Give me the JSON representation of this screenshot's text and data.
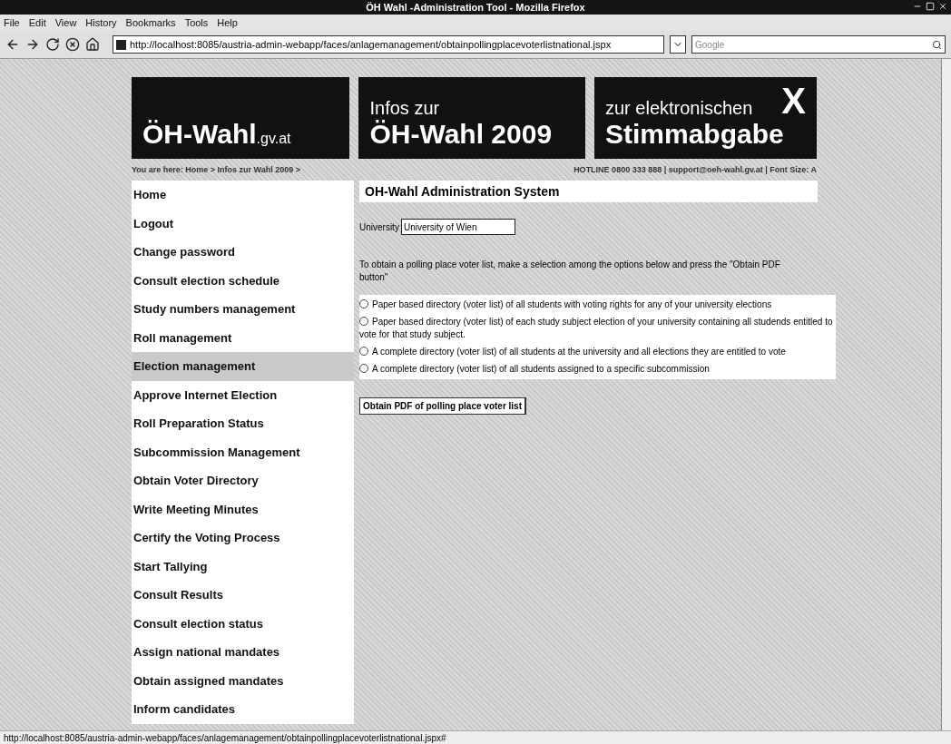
{
  "window": {
    "title": "ÖH Wahl -Administration Tool - Mozilla Firefox"
  },
  "menu": [
    "File",
    "Edit",
    "View",
    "History",
    "Bookmarks",
    "Tools",
    "Help"
  ],
  "address": {
    "url": "http://localhost:8085/austria-admin-webapp/faces/anlagemanagement/obtainpollingplacevoterlistnational.jspx"
  },
  "search": {
    "placeholder": "Google"
  },
  "banner": [
    {
      "kind": "logo",
      "main": "ÖH-Wahl",
      "suffix": ".gv.at"
    },
    {
      "kind": "headline",
      "top": "Infos zur",
      "main": "ÖH-Wahl 2009"
    },
    {
      "kind": "headline-x",
      "top": "zur elektronischen",
      "main": "Stimmabgabe",
      "mark": "X"
    }
  ],
  "breadcrumb": "You are here: Home > Infos zur Wahl 2009 >",
  "hotline": "HOTLINE 0800 333 888 | support@oeh-wahl.gv.at | Font Size: A",
  "sidebar": {
    "items": [
      {
        "label": "Home",
        "selected": false
      },
      {
        "label": "Logout",
        "selected": false
      },
      {
        "label": "Change password",
        "selected": false
      },
      {
        "label": "Consult election schedule",
        "selected": false
      },
      {
        "label": "Study numbers management",
        "selected": false
      },
      {
        "label": "Roll management",
        "selected": false
      },
      {
        "label": "Election management",
        "selected": true
      },
      {
        "label": "Approve Internet Election",
        "selected": false
      },
      {
        "label": "Roll Preparation Status",
        "selected": false
      },
      {
        "label": "Subcommission Management",
        "selected": false
      },
      {
        "label": "Obtain Voter Directory",
        "selected": false
      },
      {
        "label": "Write Meeting Minutes",
        "selected": false
      },
      {
        "label": "Certify the Voting Process",
        "selected": false
      },
      {
        "label": "Start Tallying",
        "selected": false
      },
      {
        "label": "Consult Results",
        "selected": false
      },
      {
        "label": "Consult election status",
        "selected": false
      },
      {
        "label": "Assign national mandates",
        "selected": false
      },
      {
        "label": "Obtain assigned mandates",
        "selected": false
      },
      {
        "label": "Inform candidates",
        "selected": false
      }
    ]
  },
  "content": {
    "title": "OH-Wahl Administration System",
    "university": {
      "label": "University",
      "value": "University of Wien"
    },
    "instruction": "To obtain a polling place voter list, make a selection among the options below and press the \"Obtain PDF button\"",
    "options": [
      {
        "label": "Paper based directory (voter list) of all students with voting rights for any of your university elections",
        "selected": false
      },
      {
        "label": "Paper based directory (voter list) of each study subject election of your university containing all studends entitled to vote for that study subject.",
        "selected": false
      },
      {
        "label": "A complete directory (voter list) of all students at the university and all elections they are entitled to vote",
        "selected": false
      },
      {
        "label": "A complete directory (voter list) of all students assigned to a specific subcommission",
        "selected": false
      }
    ],
    "button": "Obtain PDF of polling place voter list"
  },
  "status_bar": {
    "text": "http://localhost:8085/austria-admin-webapp/faces/anlagemanagement/obtainpollingplacevoterlistnational.jspx#"
  }
}
